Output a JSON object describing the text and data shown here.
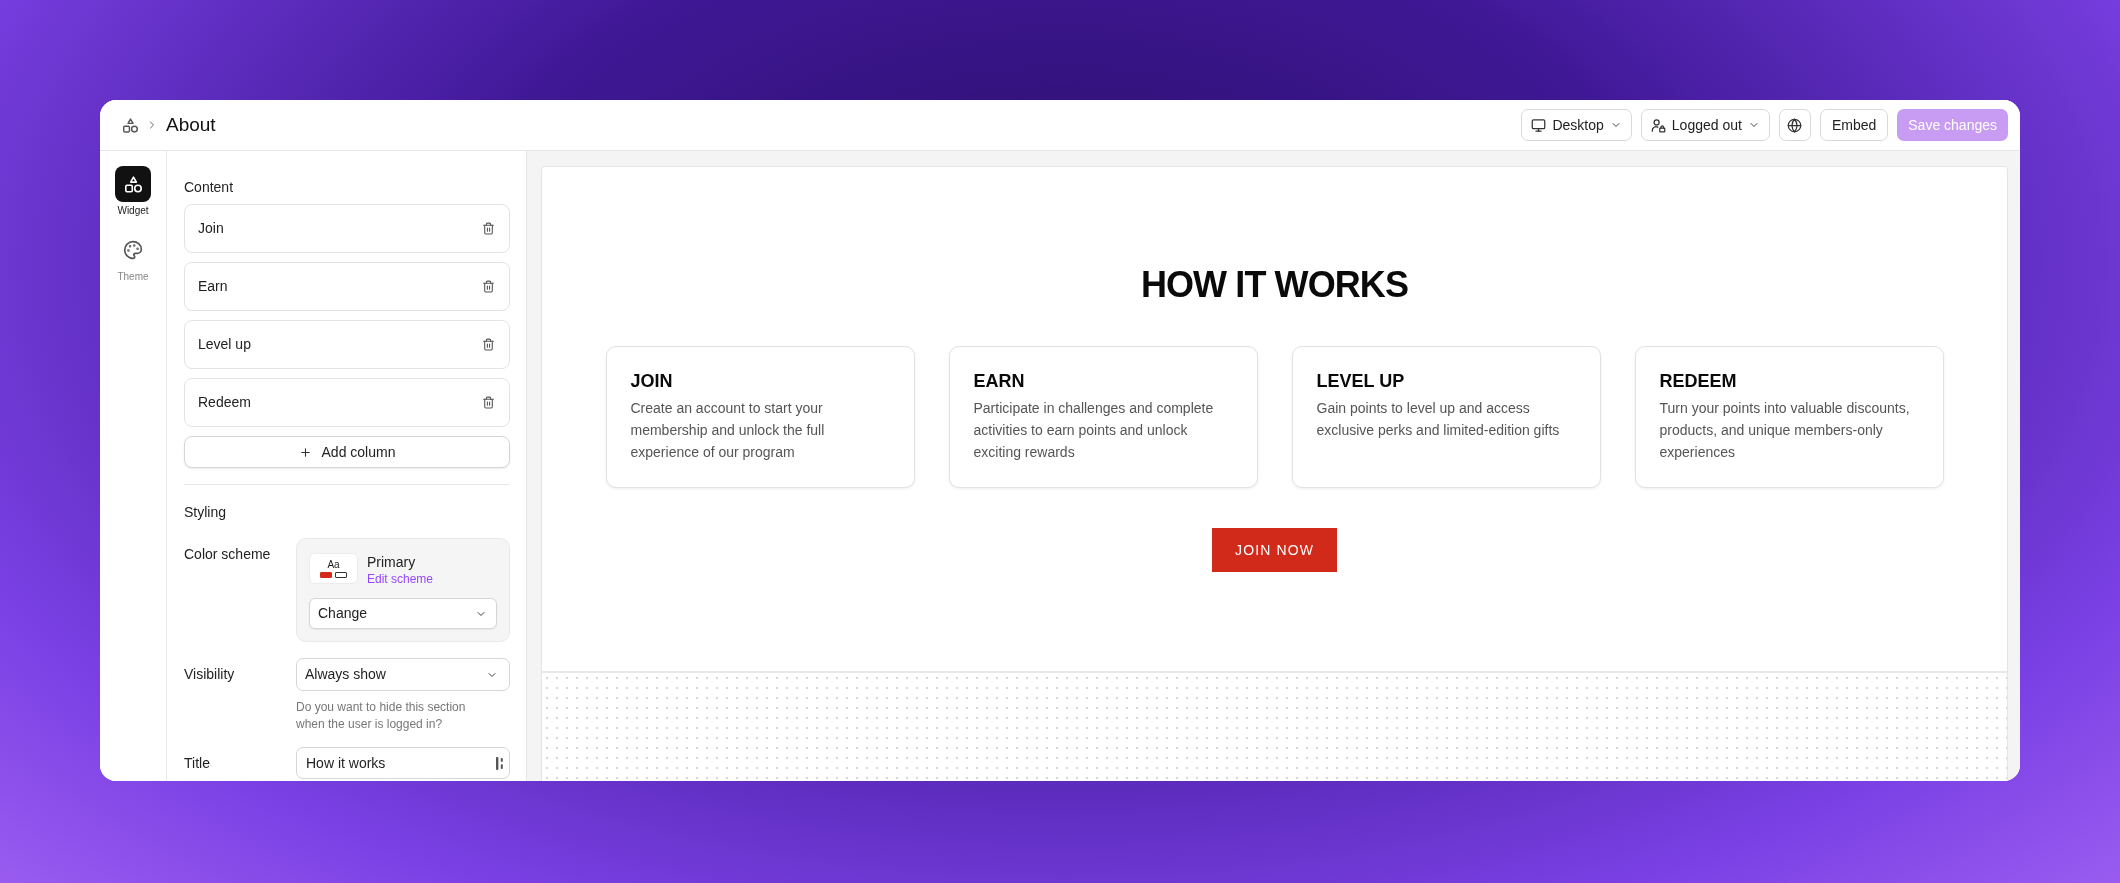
{
  "header": {
    "breadcrumb": "About",
    "device_select": "Desktop",
    "audience_select": "Logged out",
    "embed_button": "Embed",
    "save_button": {
      "label": "Save changes",
      "disabled": true
    }
  },
  "rail": [
    {
      "label": "Widget",
      "selected": true
    },
    {
      "label": "Theme",
      "selected": false
    }
  ],
  "content": {
    "title": "Content",
    "items": [
      {
        "label": "Join"
      },
      {
        "label": "Earn"
      },
      {
        "label": "Level up"
      },
      {
        "label": "Redeem"
      }
    ],
    "add_button": "Add column"
  },
  "styling": {
    "title": "Styling",
    "color_scheme": {
      "label": "Color scheme",
      "preview_text": "Aa",
      "swatches": [
        {
          "color": "#d42a1a"
        },
        {
          "color": "#ffffff"
        }
      ],
      "name": "Primary",
      "edit_link": "Edit scheme",
      "select": "Change"
    },
    "visibility": {
      "label": "Visibility",
      "value": "Always show",
      "help": "Do you want to hide this section when the user is logged in?"
    },
    "title_field": {
      "label": "Title",
      "value": "How it works"
    }
  },
  "preview": {
    "heading": "HOW IT WORKS",
    "cards": [
      {
        "title": "JOIN",
        "text": "Create an account to start your membership and unlock the full experience of our program"
      },
      {
        "title": "EARN",
        "text": "Participate in challenges and complete activities to earn points and unlock exciting rewards"
      },
      {
        "title": "LEVEL UP",
        "text": "Gain points to level up and access exclusive perks and limited-edition gifts"
      },
      {
        "title": "REDEEM",
        "text": "Turn your points into valuable discounts, products, and unique members-only experiences"
      }
    ],
    "button": "JOIN NOW"
  }
}
